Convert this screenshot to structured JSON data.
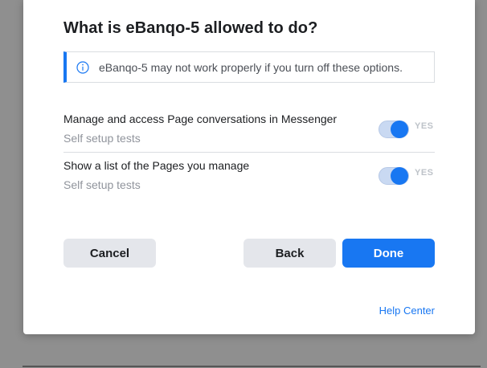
{
  "dialog": {
    "title": "What is eBanqo-5 allowed to do?",
    "notice": {
      "icon": "info-icon",
      "text": "eBanqo-5 may not work properly if you turn off these options."
    },
    "permissions": [
      {
        "title": "Manage and access Page conversations in Messenger",
        "subtitle": "Self setup tests",
        "toggle_on": true,
        "toggle_label": "YES"
      },
      {
        "title": "Show a list of the Pages you manage",
        "subtitle": "Self setup tests",
        "toggle_on": true,
        "toggle_label": "YES"
      }
    ],
    "buttons": {
      "cancel": "Cancel",
      "back": "Back",
      "done": "Done"
    },
    "help_link": "Help Center"
  },
  "colors": {
    "accent": "#1877f2",
    "overlay": "#8f8f8f",
    "button_gray": "#e4e6eb"
  }
}
